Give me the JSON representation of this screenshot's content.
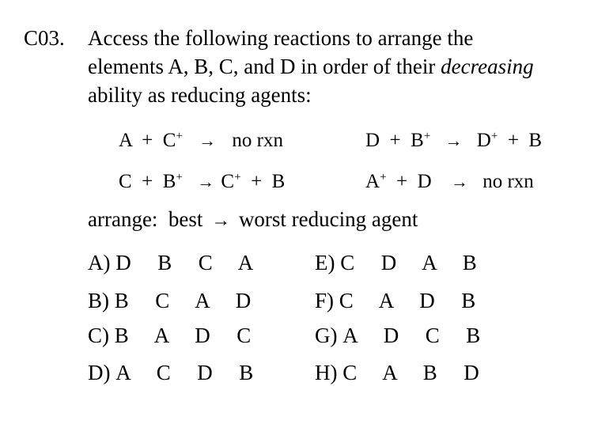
{
  "question": {
    "number": "C03.",
    "stem_line1": "Access the following reactions to arrange the",
    "stem_line2": "elements A, B, C, and D in order of their ",
    "stem_italic": "decreasing",
    "stem_line3": "ability as reducing agents:"
  },
  "reactions": [
    {
      "left": "A  +  C",
      "left_sup": "+",
      "arrow": "→",
      "right": "no rxn",
      "right_sup": ""
    },
    {
      "left": "D  +  B",
      "left_sup": "+",
      "arrow": "→",
      "right": "D",
      "right_sup": "+",
      "right_tail": "  +  B"
    },
    {
      "left": "C  +  B",
      "left_sup": "+",
      "arrow": "→",
      "right": "C",
      "right_sup": "+",
      "right_tail": "  +  B"
    },
    {
      "left": "A",
      "left_sup": "+",
      "left_tail": "  +  D",
      "arrow": "→",
      "right": "no rxn",
      "right_sup": ""
    }
  ],
  "arrange": {
    "prefix": "arrange:  best",
    "arrow": "→",
    "suffix": "worst reducing agent"
  },
  "choices": [
    {
      "letter": "A)",
      "sequence": "D  B  C  A"
    },
    {
      "letter": "E)",
      "sequence": "C  D  A  B"
    },
    {
      "letter": "B)",
      "sequence": "B  C  A  D"
    },
    {
      "letter": "F)",
      "sequence": "C  A  D  B"
    },
    {
      "letter": "C)",
      "sequence": "B  A  D  C"
    },
    {
      "letter": "G)",
      "sequence": "A  D  C  B"
    },
    {
      "letter": "D)",
      "sequence": "A  C  D  B"
    },
    {
      "letter": "H)",
      "sequence": "C  A  B  D"
    }
  ]
}
